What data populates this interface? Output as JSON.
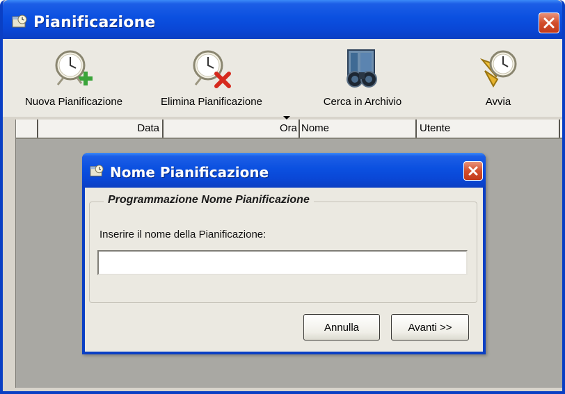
{
  "window": {
    "title": "Pianificazione",
    "close_label": "✕"
  },
  "toolbar": {
    "new_label": "Nuova Pianificazione",
    "delete_label": "Elimina Pianificazione",
    "search_label": "Cerca in Archivio",
    "run_label": "Avvia"
  },
  "table": {
    "columns": [
      "",
      "Data",
      "Ora",
      "Nome",
      "Utente"
    ]
  },
  "dialog": {
    "title": "Nome Pianificazione",
    "group_title": "Programmazione Nome Pianificazione",
    "field_label": "Inserire il nome della Pianificazione:",
    "field_value": "",
    "field_placeholder": "",
    "cancel_label": "Annulla",
    "next_label": "Avanti >>"
  },
  "icons": {
    "app": "scheduler-icon",
    "new": "clock-plus-icon",
    "delete": "clock-delete-icon",
    "search": "binoculars-icon",
    "run": "clock-start-icon",
    "close": "close-icon"
  },
  "colors": {
    "titlebar": "#0b50e0",
    "window_face": "#ebe9e2",
    "list_background": "#a9a8a3",
    "close_button": "#d24e2c"
  }
}
